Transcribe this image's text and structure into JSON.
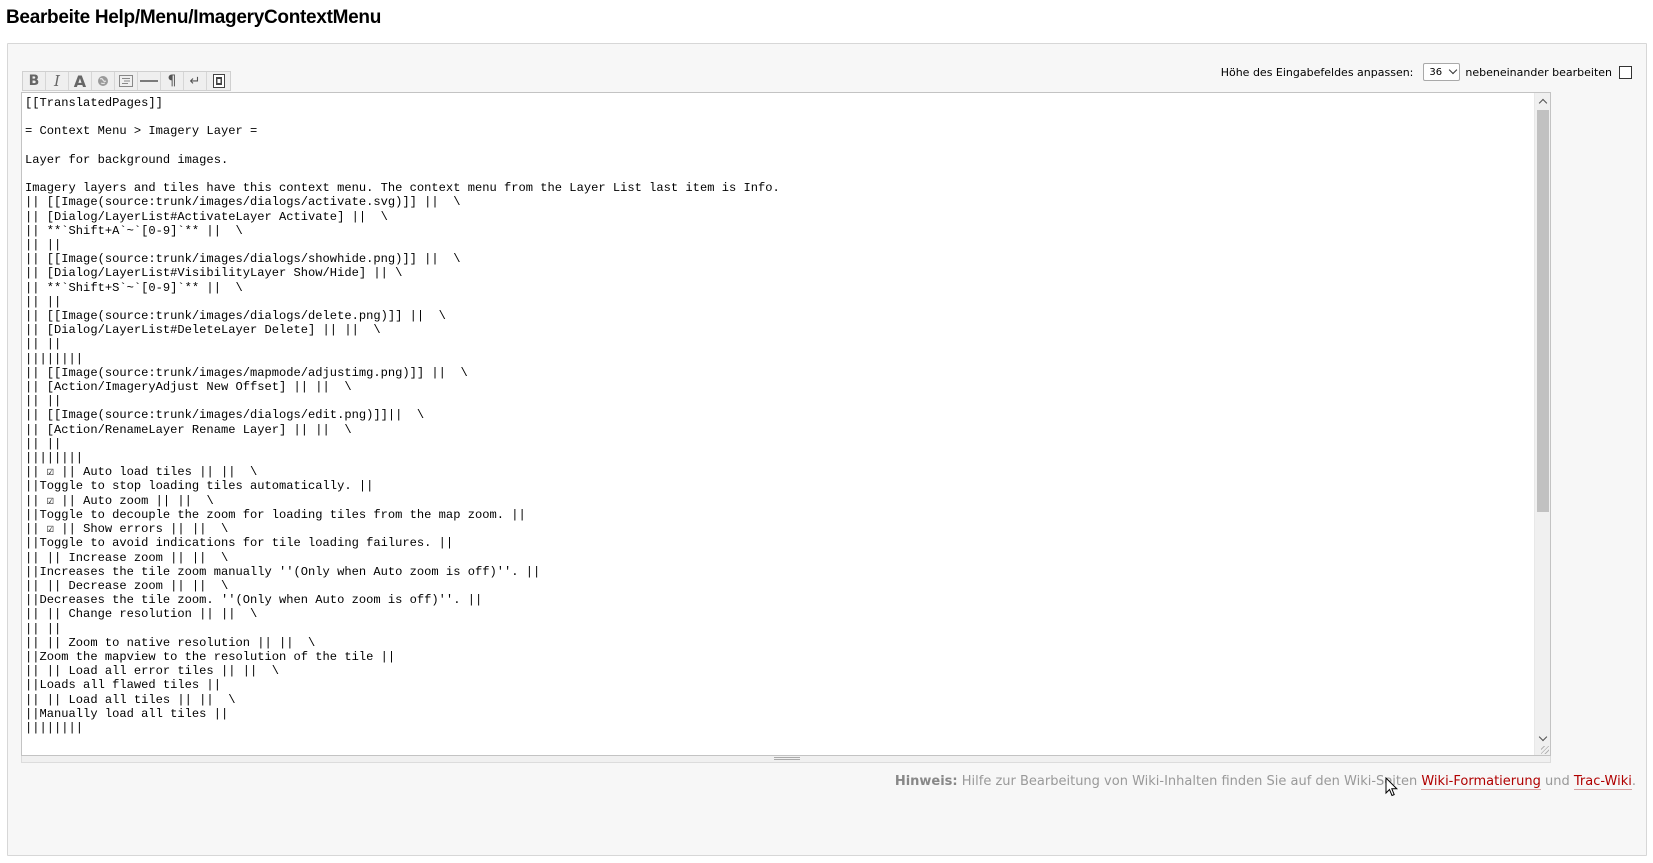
{
  "page_title": "Bearbeite Help/Menu/ImageryContextMenu",
  "controls": {
    "height_label": "Höhe des Eingabefeldes anpassen:",
    "height_value": "36",
    "side_by_side_label": "nebeneinander bearbeiten",
    "side_by_side_checked": false
  },
  "toolbar": {
    "buttons": [
      {
        "name": "bold",
        "glyph": "B"
      },
      {
        "name": "italic",
        "glyph": "I"
      },
      {
        "name": "heading",
        "glyph": "A"
      },
      {
        "name": "link",
        "icon": "globe-icon"
      },
      {
        "name": "code-block",
        "icon": "code-block-icon"
      },
      {
        "name": "horizontal-rule",
        "icon": "hr-icon"
      },
      {
        "name": "paragraph",
        "glyph": "¶"
      },
      {
        "name": "line-break",
        "glyph": "↵"
      },
      {
        "name": "image",
        "icon": "image-icon"
      }
    ]
  },
  "editor": {
    "content": "[[TranslatedPages]]\n\n= Context Menu > Imagery Layer =\n\nLayer for background images.\n\nImagery layers and tiles have this context menu. The context menu from the Layer List last item is Info.\n|| [[Image(source:trunk/images/dialogs/activate.svg)]] ||  \\\n|| [Dialog/LayerList#ActivateLayer Activate] ||  \\\n|| **`Shift+A`~`[0-9]`** ||  \\\n|| ||\n|| [[Image(source:trunk/images/dialogs/showhide.png)]] ||  \\\n|| [Dialog/LayerList#VisibilityLayer Show/Hide] || \\\n|| **`Shift+S`~`[0-9]`** ||  \\\n|| ||\n|| [[Image(source:trunk/images/dialogs/delete.png)]] ||  \\\n|| [Dialog/LayerList#DeleteLayer Delete] || ||  \\\n|| ||\n||||||||\n|| [[Image(source:trunk/images/mapmode/adjustimg.png)]] ||  \\\n|| [Action/ImageryAdjust New Offset] || ||  \\\n|| ||\n|| [[Image(source:trunk/images/dialogs/edit.png)]]||  \\\n|| [Action/RenameLayer Rename Layer] || ||  \\\n|| ||\n||||||||\n|| ☑ || Auto load tiles || ||  \\\n||Toggle to stop loading tiles automatically. ||\n|| ☑ || Auto zoom || ||  \\\n||Toggle to decouple the zoom for loading tiles from the map zoom. ||\n|| ☑ || Show errors || ||  \\\n||Toggle to avoid indications for tile loading failures. ||\n|| || Increase zoom || ||  \\\n||Increases the tile zoom manually ''(Only when Auto zoom is off)''. ||\n|| || Decrease zoom || ||  \\\n||Decreases the tile zoom. ''(Only when Auto zoom is off)''. ||\n|| || Change resolution || ||  \\\n|| ||\n|| || Zoom to native resolution || ||  \\\n||Zoom the mapview to the resolution of the tile ||\n|| || Load all error tiles || ||  \\\n||Loads all flawed tiles ||\n|| || Load all tiles || ||  \\\n||Manually load all tiles ||\n||||||||"
  },
  "hint": {
    "prefix_bold": "Hinweis:",
    "text": " Hilfe zur Bearbeitung von Wiki-Inhalten finden Sie auf den Wiki-Seiten ",
    "link1": "Wiki-Formatierung",
    "between": " und ",
    "link2": "Trac-Wiki",
    "suffix": "."
  },
  "colors": {
    "link": "#b00000",
    "hint_text": "#999999",
    "fieldset_bg": "#f7f7f7"
  }
}
